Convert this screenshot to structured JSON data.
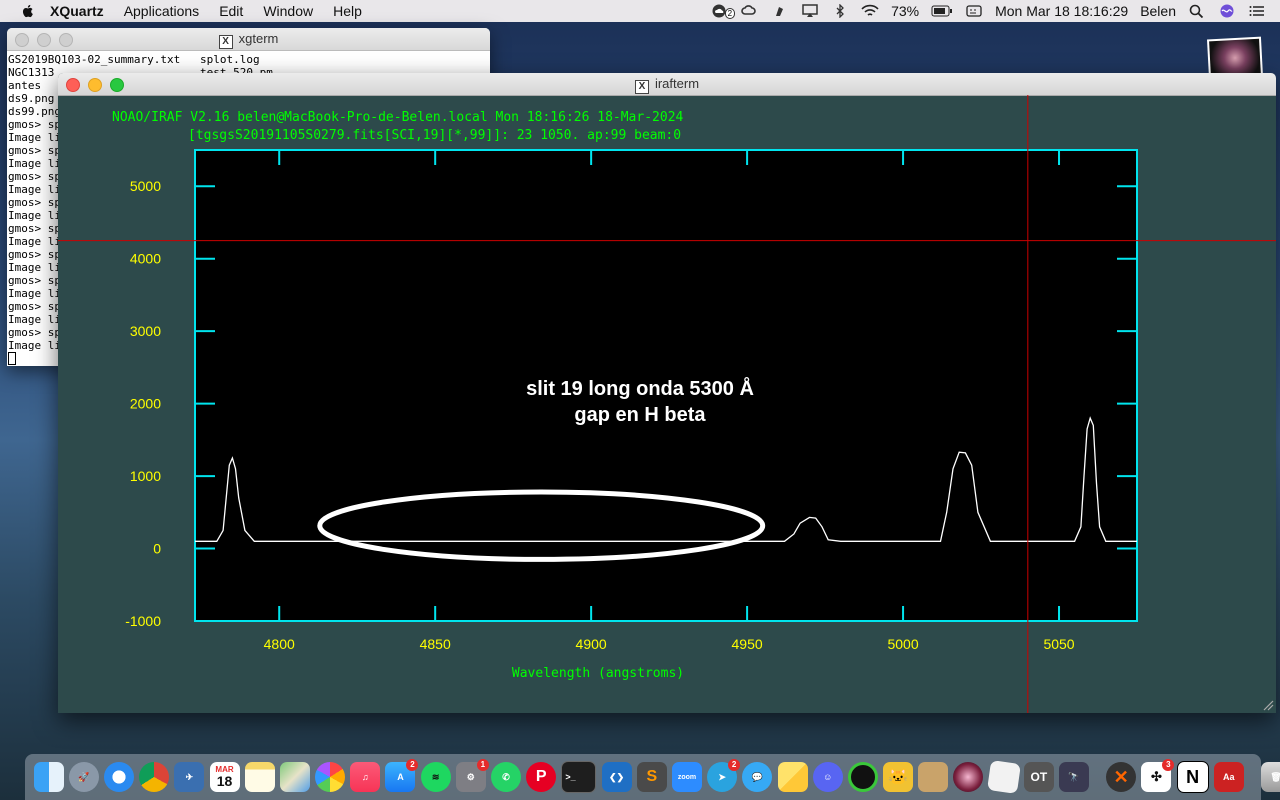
{
  "menubar": {
    "app_name": "XQuartz",
    "items": [
      "Applications",
      "Edit",
      "Window",
      "Help"
    ],
    "status": {
      "notification_count": "2",
      "battery": "73%",
      "clock": "Mon Mar 18  18:16:29",
      "user": "Belen"
    }
  },
  "xgterm": {
    "title": "xgterm",
    "col1": [
      "GS2019BQ103-02_summary.txt",
      "NGC1313",
      "antes",
      "ds9.png",
      "ds99.png",
      "gmos> sp",
      "Image li",
      "gmos> sp",
      "Image li",
      "gmos> sp",
      "Image li",
      "gmos> sp",
      "Image li",
      "gmos> sp",
      "Image li",
      "gmos> sp",
      "Image li",
      "gmos> sp",
      "Image li",
      "gmos> sp",
      "Image li",
      "gmos> sp",
      "Image li"
    ],
    "col2": [
      "splot.log",
      "test_520.pm"
    ]
  },
  "irafterm": {
    "title": "irafterm",
    "header1": "NOAO/IRAF V2.16 belen@MacBook-Pro-de-Belen.local Mon 18:16:26 18-Mar-2024",
    "header2": "[tgsgsS20191105S0279.fits[SCI,19][*,99]]: 23 1050. ap:99 beam:0",
    "annotation1": "slit 19 long onda 5300 Å",
    "annotation2": "gap en H beta"
  },
  "chart_data": {
    "type": "line",
    "title": "[tgsgsS20191105S0279.fits[SCI,19][*,99]]: 23 1050. ap:99 beam:0",
    "xlabel": "Wavelength (angstroms)",
    "ylabel": "",
    "xlim": [
      4773,
      5075
    ],
    "ylim": [
      -1000,
      5500
    ],
    "xticks": [
      4800,
      4850,
      4900,
      4950,
      5000,
      5050
    ],
    "yticks": [
      -1000,
      0,
      1000,
      2000,
      3000,
      4000,
      5000
    ],
    "grid": false,
    "colors": {
      "frame": "#00e5ee",
      "ytick_labels": "#ffff00",
      "xtick_labels": "#ffff00",
      "line": "#ffffff",
      "text": "#00ff00",
      "cursor": "#cc0000"
    },
    "cursor": {
      "x": 5040,
      "y": 4250
    },
    "series": [
      {
        "values_x": [
          4773,
          4777,
          4780,
          4782,
          4783,
          4784,
          4785,
          4786,
          4787,
          4789,
          4792,
          4800,
          4820,
          4850,
          4880,
          4900,
          4930,
          4950,
          4962,
          4965,
          4967,
          4970,
          4972,
          4974,
          4976,
          4980,
          5000,
          5012,
          5014,
          5016,
          5018,
          5020,
          5022,
          5024,
          5028,
          5040,
          5055,
          5057,
          5058,
          5059,
          5060,
          5061,
          5062,
          5063,
          5065,
          5075
        ],
        "values_y": [
          100,
          100,
          100,
          250,
          700,
          1150,
          1250,
          1100,
          700,
          250,
          100,
          100,
          100,
          100,
          100,
          100,
          100,
          100,
          100,
          200,
          350,
          430,
          420,
          300,
          120,
          100,
          100,
          100,
          500,
          1100,
          1330,
          1320,
          1150,
          500,
          100,
          100,
          100,
          300,
          1000,
          1650,
          1800,
          1700,
          900,
          300,
          100,
          100
        ]
      }
    ],
    "annotation_ellipse_x": [
      4813,
      4955
    ],
    "annotation_ellipse_y": [
      -150,
      780
    ]
  },
  "dock": {
    "badges": {
      "calendar_month": "MAR",
      "calendar_day": "18",
      "appstore": "2",
      "settings": "1",
      "telegram": "2",
      "sketch": "3"
    }
  }
}
